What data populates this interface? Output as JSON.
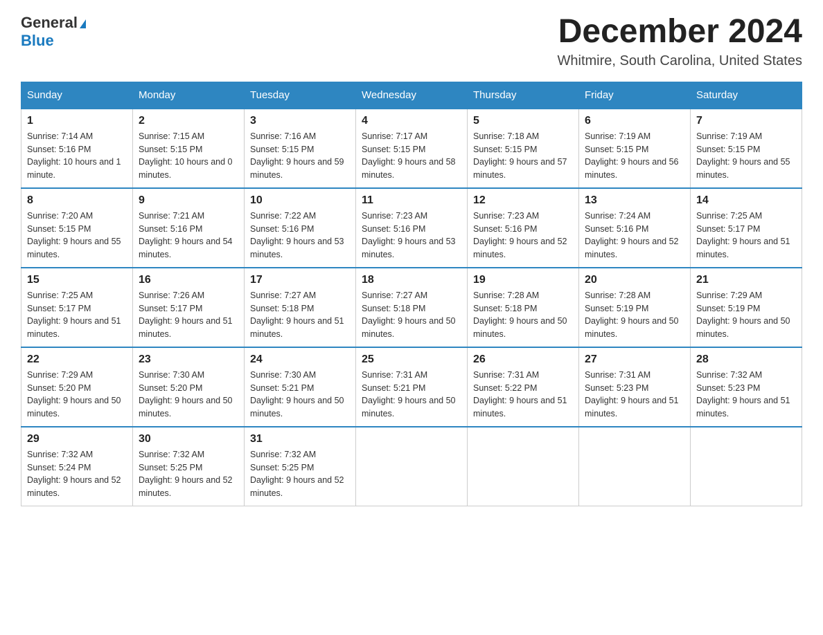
{
  "logo": {
    "line1": "General",
    "line2": "Blue"
  },
  "title": {
    "month": "December 2024",
    "location": "Whitmire, South Carolina, United States"
  },
  "days": [
    "Sunday",
    "Monday",
    "Tuesday",
    "Wednesday",
    "Thursday",
    "Friday",
    "Saturday"
  ],
  "weeks": [
    [
      {
        "num": "1",
        "sunrise": "7:14 AM",
        "sunset": "5:16 PM",
        "daylight": "10 hours and 1 minute."
      },
      {
        "num": "2",
        "sunrise": "7:15 AM",
        "sunset": "5:15 PM",
        "daylight": "10 hours and 0 minutes."
      },
      {
        "num": "3",
        "sunrise": "7:16 AM",
        "sunset": "5:15 PM",
        "daylight": "9 hours and 59 minutes."
      },
      {
        "num": "4",
        "sunrise": "7:17 AM",
        "sunset": "5:15 PM",
        "daylight": "9 hours and 58 minutes."
      },
      {
        "num": "5",
        "sunrise": "7:18 AM",
        "sunset": "5:15 PM",
        "daylight": "9 hours and 57 minutes."
      },
      {
        "num": "6",
        "sunrise": "7:19 AM",
        "sunset": "5:15 PM",
        "daylight": "9 hours and 56 minutes."
      },
      {
        "num": "7",
        "sunrise": "7:19 AM",
        "sunset": "5:15 PM",
        "daylight": "9 hours and 55 minutes."
      }
    ],
    [
      {
        "num": "8",
        "sunrise": "7:20 AM",
        "sunset": "5:15 PM",
        "daylight": "9 hours and 55 minutes."
      },
      {
        "num": "9",
        "sunrise": "7:21 AM",
        "sunset": "5:16 PM",
        "daylight": "9 hours and 54 minutes."
      },
      {
        "num": "10",
        "sunrise": "7:22 AM",
        "sunset": "5:16 PM",
        "daylight": "9 hours and 53 minutes."
      },
      {
        "num": "11",
        "sunrise": "7:23 AM",
        "sunset": "5:16 PM",
        "daylight": "9 hours and 53 minutes."
      },
      {
        "num": "12",
        "sunrise": "7:23 AM",
        "sunset": "5:16 PM",
        "daylight": "9 hours and 52 minutes."
      },
      {
        "num": "13",
        "sunrise": "7:24 AM",
        "sunset": "5:16 PM",
        "daylight": "9 hours and 52 minutes."
      },
      {
        "num": "14",
        "sunrise": "7:25 AM",
        "sunset": "5:17 PM",
        "daylight": "9 hours and 51 minutes."
      }
    ],
    [
      {
        "num": "15",
        "sunrise": "7:25 AM",
        "sunset": "5:17 PM",
        "daylight": "9 hours and 51 minutes."
      },
      {
        "num": "16",
        "sunrise": "7:26 AM",
        "sunset": "5:17 PM",
        "daylight": "9 hours and 51 minutes."
      },
      {
        "num": "17",
        "sunrise": "7:27 AM",
        "sunset": "5:18 PM",
        "daylight": "9 hours and 51 minutes."
      },
      {
        "num": "18",
        "sunrise": "7:27 AM",
        "sunset": "5:18 PM",
        "daylight": "9 hours and 50 minutes."
      },
      {
        "num": "19",
        "sunrise": "7:28 AM",
        "sunset": "5:18 PM",
        "daylight": "9 hours and 50 minutes."
      },
      {
        "num": "20",
        "sunrise": "7:28 AM",
        "sunset": "5:19 PM",
        "daylight": "9 hours and 50 minutes."
      },
      {
        "num": "21",
        "sunrise": "7:29 AM",
        "sunset": "5:19 PM",
        "daylight": "9 hours and 50 minutes."
      }
    ],
    [
      {
        "num": "22",
        "sunrise": "7:29 AM",
        "sunset": "5:20 PM",
        "daylight": "9 hours and 50 minutes."
      },
      {
        "num": "23",
        "sunrise": "7:30 AM",
        "sunset": "5:20 PM",
        "daylight": "9 hours and 50 minutes."
      },
      {
        "num": "24",
        "sunrise": "7:30 AM",
        "sunset": "5:21 PM",
        "daylight": "9 hours and 50 minutes."
      },
      {
        "num": "25",
        "sunrise": "7:31 AM",
        "sunset": "5:21 PM",
        "daylight": "9 hours and 50 minutes."
      },
      {
        "num": "26",
        "sunrise": "7:31 AM",
        "sunset": "5:22 PM",
        "daylight": "9 hours and 51 minutes."
      },
      {
        "num": "27",
        "sunrise": "7:31 AM",
        "sunset": "5:23 PM",
        "daylight": "9 hours and 51 minutes."
      },
      {
        "num": "28",
        "sunrise": "7:32 AM",
        "sunset": "5:23 PM",
        "daylight": "9 hours and 51 minutes."
      }
    ],
    [
      {
        "num": "29",
        "sunrise": "7:32 AM",
        "sunset": "5:24 PM",
        "daylight": "9 hours and 52 minutes."
      },
      {
        "num": "30",
        "sunrise": "7:32 AM",
        "sunset": "5:25 PM",
        "daylight": "9 hours and 52 minutes."
      },
      {
        "num": "31",
        "sunrise": "7:32 AM",
        "sunset": "5:25 PM",
        "daylight": "9 hours and 52 minutes."
      },
      null,
      null,
      null,
      null
    ]
  ]
}
